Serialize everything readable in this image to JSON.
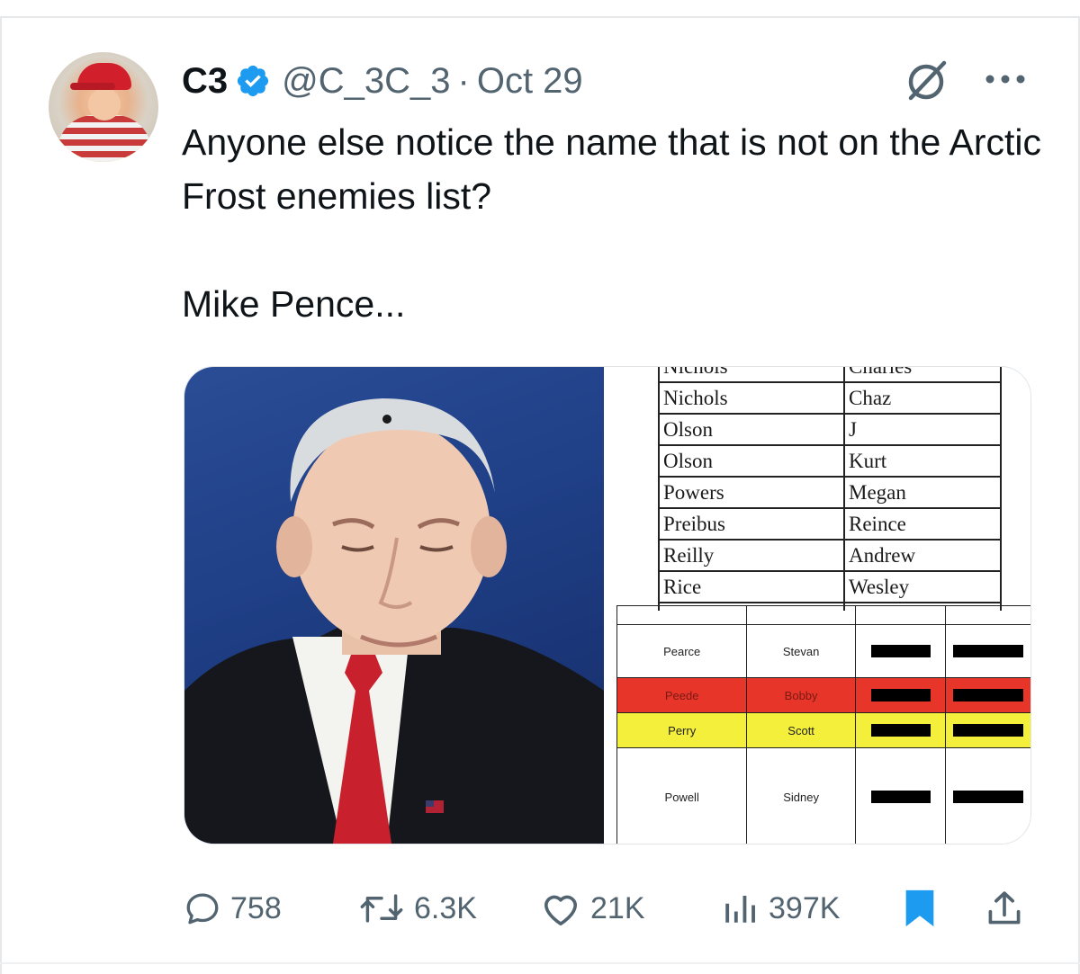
{
  "tweet": {
    "display_name": "C3",
    "handle": "@C_3C_3",
    "separator": "·",
    "date": "Oct 29",
    "text": "Anyone else notice the name that is not on the Arctic Frost enemies list?\n\nMike Pence..."
  },
  "icons": {
    "verified": "verified-badge-icon",
    "grok": "grok-icon",
    "more": "more-icon",
    "reply": "reply-icon",
    "retweet": "retweet-icon",
    "like": "heart-icon",
    "views": "views-icon",
    "bookmark": "bookmark-icon",
    "share": "share-icon"
  },
  "colors": {
    "accent": "#1d9bf0",
    "secondary_text": "#536471",
    "highlight_red": "#e8352a",
    "highlight_yellow": "#f4ef3a"
  },
  "media": {
    "list_top": {
      "header_cut": [
        "Nichols",
        "Charles"
      ],
      "rows": [
        [
          "Nichols",
          "Chaz"
        ],
        [
          "Olson",
          "J"
        ],
        [
          "Olson",
          "Kurt"
        ],
        [
          "Powers",
          "Megan"
        ],
        [
          "Preibus",
          "Reince"
        ],
        [
          "Reilly",
          "Andrew"
        ],
        [
          "Rice",
          "Wesley"
        ]
      ]
    },
    "list_bottom": {
      "rows": [
        [
          "Pearce",
          "Stevan"
        ],
        [
          "Peede",
          "Bobby"
        ],
        [
          "Perry",
          "Scott"
        ],
        [
          "Powell",
          "Sidney"
        ]
      ]
    }
  },
  "metrics": {
    "replies": "758",
    "retweets": "6.3K",
    "likes": "21K",
    "views": "397K"
  }
}
